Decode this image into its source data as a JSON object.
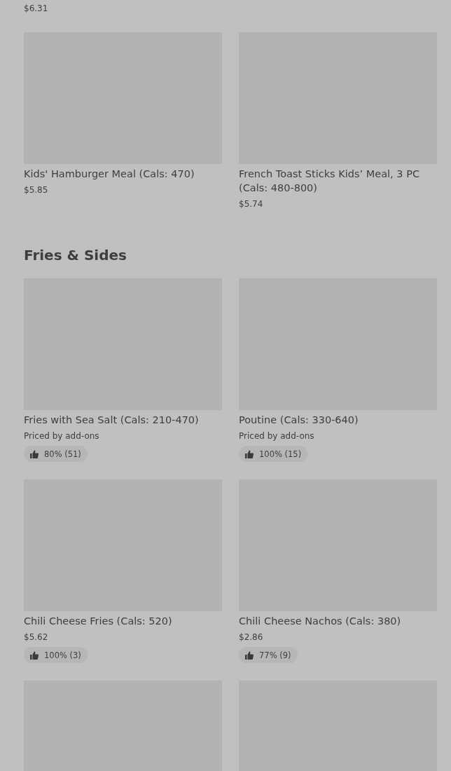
{
  "top_item": {
    "price": "$6.31"
  },
  "kids_items": [
    {
      "kind": "item",
      "name": "Kids' Hamburger Meal (Cals: 470)",
      "price": "$5.85"
    },
    {
      "kind": "item",
      "name": "French Toast Sticks Kids’ Meal, 3 PC (Cals: 480-800)",
      "price": "$5.74"
    }
  ],
  "sections": [
    {
      "title": "Fries & Sides",
      "items": [
        {
          "kind": "item",
          "name": "Fries with Sea Salt (Cals: 210-470)",
          "price": "Priced by add-ons",
          "rating": "80% (51)"
        },
        {
          "kind": "item",
          "name": "Poutine (Cals: 330-640)",
          "price": "Priced by add-ons",
          "rating": "100% (15)"
        },
        {
          "kind": "item",
          "name": "Chili Cheese Fries (Cals: 520)",
          "price": "$5.62",
          "rating": "100% (3)"
        },
        {
          "kind": "item",
          "name": "Chili Cheese Nachos (Cals: 380)",
          "price": "$2.86",
          "rating": "77% (9)"
        },
        {
          "kind": "image_only"
        },
        {
          "kind": "image_only"
        }
      ]
    }
  ]
}
